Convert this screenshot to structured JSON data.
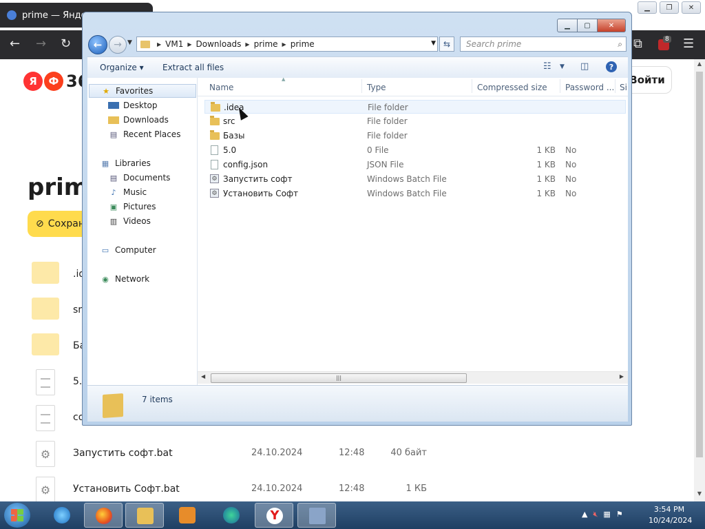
{
  "browser": {
    "tab_title": "prime — Яндекс",
    "login_label": "Войти",
    "logo_text": "36",
    "logo_c1": "Я",
    "logo_c2": "Ф",
    "page_title": "prim",
    "save_label": "Сохран",
    "badge_count": "8",
    "rows": [
      {
        "name": ".id",
        "date": "",
        "time": "",
        "size": "",
        "kind": "folder"
      },
      {
        "name": "src",
        "date": "",
        "time": "",
        "size": "",
        "kind": "folder"
      },
      {
        "name": "Ба",
        "date": "",
        "time": "",
        "size": "",
        "kind": "folder"
      },
      {
        "name": "5.0",
        "date": "",
        "time": "",
        "size": "",
        "kind": "doc"
      },
      {
        "name": "co",
        "date": "",
        "time": "",
        "size": "",
        "kind": "doc"
      },
      {
        "name": "Запустить софт.bat",
        "date": "24.10.2024",
        "time": "12:48",
        "size": "40 байт",
        "kind": "gear"
      },
      {
        "name": "Установить Софт.bat",
        "date": "24.10.2024",
        "time": "12:48",
        "size": "1 КБ",
        "kind": "gear"
      }
    ]
  },
  "explorer": {
    "breadcrumb": [
      "VM1",
      "Downloads",
      "prime",
      "prime"
    ],
    "search_placeholder": "Search prime",
    "toolbar": {
      "organize": "Organize",
      "extract": "Extract all files"
    },
    "nav": {
      "favorites": "Favorites",
      "desktop": "Desktop",
      "downloads": "Downloads",
      "recent": "Recent Places",
      "libraries": "Libraries",
      "documents": "Documents",
      "music": "Music",
      "pictures": "Pictures",
      "videos": "Videos",
      "computer": "Computer",
      "network": "Network"
    },
    "columns": {
      "name": "Name",
      "type": "Type",
      "compressed": "Compressed size",
      "password": "Password ...",
      "size": "Si"
    },
    "files": [
      {
        "name": ".idea",
        "type": "File folder",
        "size": "",
        "password": "",
        "icon": "folder"
      },
      {
        "name": "src",
        "type": "File folder",
        "size": "",
        "password": "",
        "icon": "folder"
      },
      {
        "name": "Базы",
        "type": "File folder",
        "size": "",
        "password": "",
        "icon": "folder"
      },
      {
        "name": "5.0",
        "type": "0 File",
        "size": "1 KB",
        "password": "No",
        "icon": "file"
      },
      {
        "name": "config.json",
        "type": "JSON File",
        "size": "1 KB",
        "password": "No",
        "icon": "file"
      },
      {
        "name": "Запустить софт",
        "type": "Windows Batch File",
        "size": "1 KB",
        "password": "No",
        "icon": "bat"
      },
      {
        "name": "Установить Софт",
        "type": "Windows Batch File",
        "size": "1 KB",
        "password": "No",
        "icon": "bat"
      }
    ],
    "status": "7 items"
  },
  "taskbar": {
    "time": "3:54 PM",
    "date": "10/24/2024"
  },
  "colors": {
    "browser_chrome": "#2b2b2e",
    "taskbar": "#2a4c73",
    "save_button": "#ffdb4d",
    "folder": "#e8c058"
  }
}
